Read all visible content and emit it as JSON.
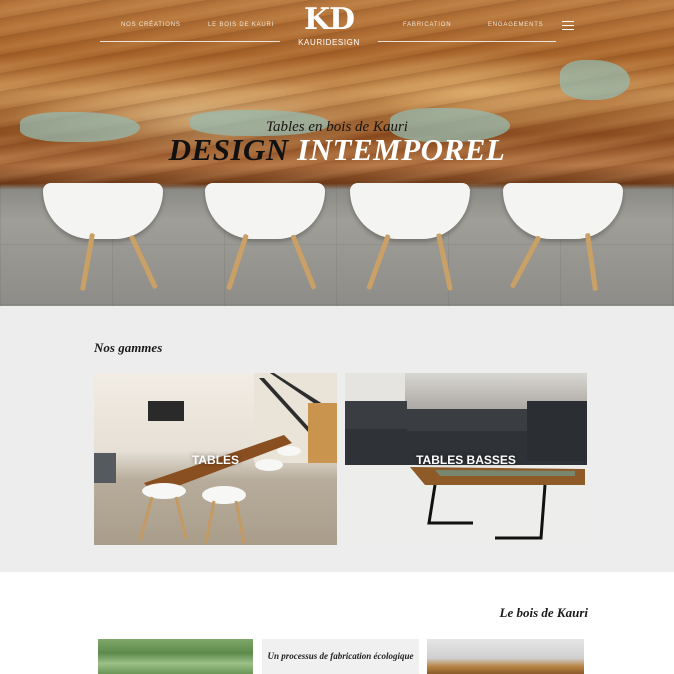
{
  "nav": {
    "left": [
      "NOS CRÉATIONS",
      "LE BOIS DE KAURI"
    ],
    "right": [
      "FABRICATION",
      "ENGAGEMENTS"
    ],
    "logo_mark": "KD",
    "logo_text": "KAURIDESIGN",
    "menu_icon": "hamburger-icon"
  },
  "hero": {
    "subtitle": "Tables en bois de Kauri",
    "title_dark": "DESIGN",
    "title_light": "INTEMPOREL"
  },
  "gammes": {
    "heading": "Nos gammes",
    "cards": [
      {
        "label": "TABLES"
      },
      {
        "label": "TABLES BASSES"
      }
    ]
  },
  "kauri": {
    "heading": "Le bois de Kauri",
    "process_text": "Un processus de fabrication écologique"
  },
  "colors": {
    "section_bg": "#ededed",
    "text_dark": "#1a1a1a",
    "nav_text": "#f3e6d4"
  }
}
